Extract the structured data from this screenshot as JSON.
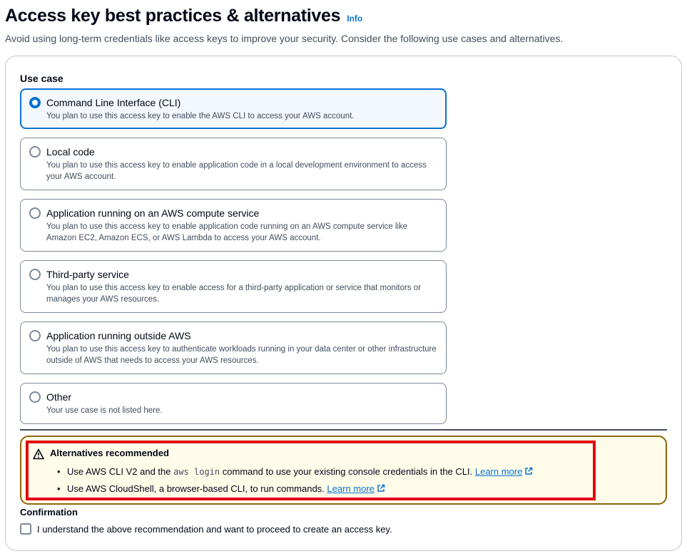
{
  "header": {
    "title": "Access key best practices & alternatives",
    "info_label": "Info",
    "description": "Avoid using long-term credentials like access keys to improve your security. Consider the following use cases and alternatives."
  },
  "use_case": {
    "label": "Use case",
    "selected_index": 0,
    "options": [
      {
        "title": "Command Line Interface (CLI)",
        "description": "You plan to use this access key to enable the AWS CLI to access your AWS account."
      },
      {
        "title": "Local code",
        "description": "You plan to use this access key to enable application code in a local development environment to access your AWS account."
      },
      {
        "title": "Application running on an AWS compute service",
        "description": "You plan to use this access key to enable application code running on an AWS compute service like Amazon EC2, Amazon ECS, or AWS Lambda to access your AWS account."
      },
      {
        "title": "Third-party service",
        "description": "You plan to use this access key to enable access for a third-party application or service that monitors or manages your AWS resources."
      },
      {
        "title": "Application running outside AWS",
        "description": "You plan to use this access key to authenticate workloads running in your data center or other infrastructure outside of AWS that needs to access your AWS resources."
      },
      {
        "title": "Other",
        "description": "Your use case is not listed here."
      }
    ]
  },
  "alert": {
    "title": "Alternatives recommended",
    "icon": "warning-icon",
    "items": [
      {
        "before": "Use AWS CLI V2 and the",
        "code": "aws login",
        "after": "command to use your existing console credentials in the CLI.",
        "link": "Learn more"
      },
      {
        "before": "Use AWS CloudShell, a browser-based CLI, to run commands.",
        "link": "Learn more"
      }
    ]
  },
  "confirmation": {
    "label": "Confirmation",
    "checkbox_label": "I understand the above recommendation and want to proceed to create an access key.",
    "checked": false
  },
  "colors": {
    "accent": "#0972d3",
    "warning_border": "#8d6605",
    "warning_bg": "#fffce9",
    "highlight": "#e0090f"
  }
}
